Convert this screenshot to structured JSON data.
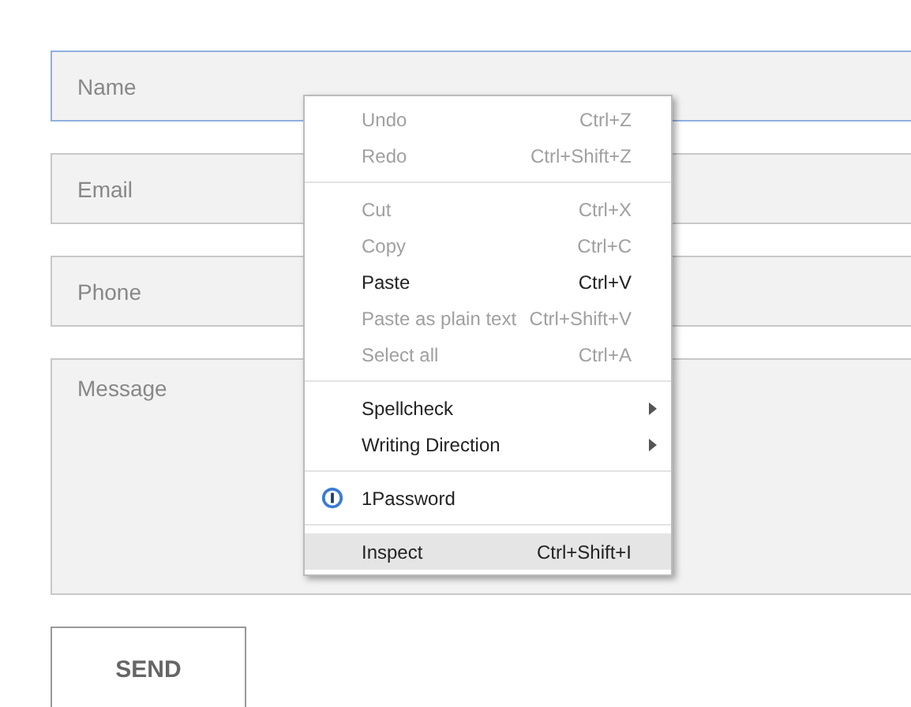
{
  "form": {
    "fields": [
      {
        "kind": "input",
        "placeholder": "Name",
        "focused": true
      },
      {
        "kind": "input",
        "placeholder": "Email",
        "focused": false
      },
      {
        "kind": "input",
        "placeholder": "Phone",
        "focused": false
      },
      {
        "kind": "textarea",
        "placeholder": "Message",
        "focused": false
      }
    ],
    "submit": "SEND"
  },
  "context_menu": {
    "groups": [
      [
        {
          "kind": "command",
          "label": "Undo",
          "shortcut": "Ctrl+Z",
          "disabled": true,
          "highlighted": false
        },
        {
          "kind": "command",
          "label": "Redo",
          "shortcut": "Ctrl+Shift+Z",
          "disabled": true,
          "highlighted": false
        }
      ],
      [
        {
          "kind": "command",
          "label": "Cut",
          "shortcut": "Ctrl+X",
          "disabled": true,
          "highlighted": false
        },
        {
          "kind": "command",
          "label": "Copy",
          "shortcut": "Ctrl+C",
          "disabled": true,
          "highlighted": false
        },
        {
          "kind": "command",
          "label": "Paste",
          "shortcut": "Ctrl+V",
          "disabled": false,
          "highlighted": false
        },
        {
          "kind": "command",
          "label": "Paste as plain text",
          "shortcut": "Ctrl+Shift+V",
          "disabled": true,
          "highlighted": false
        },
        {
          "kind": "command",
          "label": "Select all",
          "shortcut": "Ctrl+A",
          "disabled": true,
          "highlighted": false
        }
      ],
      [
        {
          "kind": "submenu",
          "label": "Spellcheck",
          "disabled": false,
          "highlighted": false
        },
        {
          "kind": "submenu",
          "label": "Writing Direction",
          "disabled": false,
          "highlighted": false
        }
      ],
      [
        {
          "kind": "extension",
          "label": "1Password",
          "disabled": false,
          "highlighted": false
        }
      ],
      [
        {
          "kind": "command",
          "label": "Inspect",
          "shortcut": "Ctrl+Shift+I",
          "disabled": false,
          "highlighted": true
        }
      ]
    ]
  }
}
